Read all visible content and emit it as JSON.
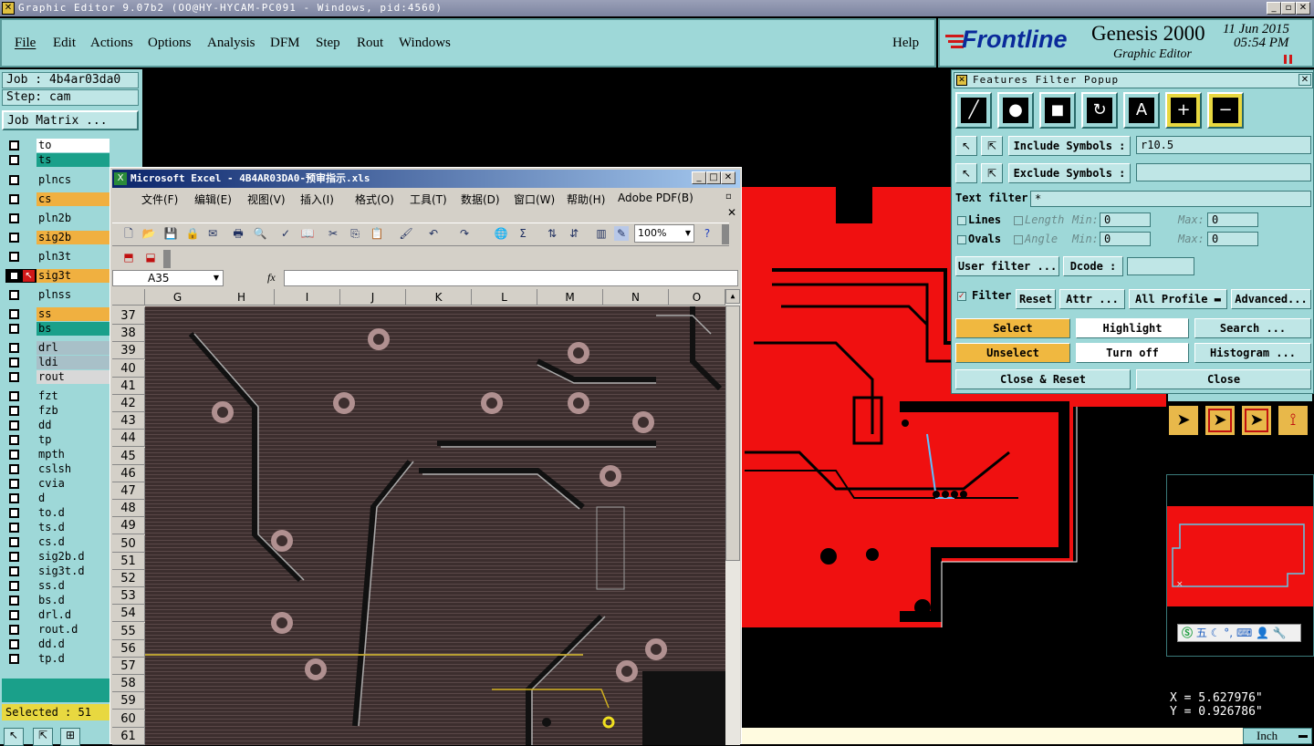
{
  "window": {
    "title": "Graphic Editor 9.07b2 (OO@HY-HYCAM-PC091 - Windows, pid:4560)"
  },
  "menubar": {
    "items": [
      "File",
      "Edit",
      "Actions",
      "Options",
      "Analysis",
      "DFM",
      "Step",
      "Rout",
      "Windows"
    ],
    "help": "Help"
  },
  "brand": {
    "logo": "Frontline",
    "product": "Genesis 2000",
    "subtitle": "Graphic Editor",
    "date": "11 Jun 2015",
    "time": "05:54 PM"
  },
  "leftpanel": {
    "job": "Job : 4b4ar03da0",
    "step": "Step: cam",
    "matrix": "Job Matrix ...",
    "selected": "Selected : 51",
    "layers": [
      {
        "name": "to",
        "color": "#ffffff"
      },
      {
        "name": "ts",
        "color": "#1aa08a"
      },
      {
        "name": "plncs",
        "color": "#9ed8d8"
      },
      {
        "name": "cs",
        "color": "#f0b040"
      },
      {
        "name": "pln2b",
        "color": "#9ed8d8"
      },
      {
        "name": "sig2b",
        "color": "#f0b040"
      },
      {
        "name": "pln3t",
        "color": "#9ed8d8"
      },
      {
        "name": "sig3t",
        "color": "#f0b040"
      },
      {
        "name": "plnss",
        "color": "#9ed8d8"
      },
      {
        "name": "ss",
        "color": "#f0b040"
      },
      {
        "name": "bs",
        "color": "#1aa08a"
      },
      {
        "name": "drl",
        "color": "#a8c0c8"
      },
      {
        "name": "ldi",
        "color": "#a8c0c8"
      },
      {
        "name": "rout",
        "color": "#d8d8d8"
      },
      {
        "name": "fzt",
        "color": "#9ed8d8"
      },
      {
        "name": "fzb",
        "color": "#9ed8d8"
      },
      {
        "name": "dd",
        "color": "#9ed8d8"
      },
      {
        "name": "tp",
        "color": "#9ed8d8"
      },
      {
        "name": "mpth",
        "color": "#9ed8d8"
      },
      {
        "name": "cslsh",
        "color": "#9ed8d8"
      },
      {
        "name": "cvia",
        "color": "#9ed8d8"
      },
      {
        "name": "d",
        "color": "#9ed8d8"
      },
      {
        "name": "to.d",
        "color": "#9ed8d8"
      },
      {
        "name": "ts.d",
        "color": "#9ed8d8"
      },
      {
        "name": "cs.d",
        "color": "#9ed8d8"
      },
      {
        "name": "sig2b.d",
        "color": "#9ed8d8"
      },
      {
        "name": "sig3t.d",
        "color": "#9ed8d8"
      },
      {
        "name": "ss.d",
        "color": "#9ed8d8"
      },
      {
        "name": "bs.d",
        "color": "#9ed8d8"
      },
      {
        "name": "drl.d",
        "color": "#9ed8d8"
      },
      {
        "name": "rout.d",
        "color": "#9ed8d8"
      },
      {
        "name": "dd.d",
        "color": "#9ed8d8"
      },
      {
        "name": "tp.d",
        "color": "#9ed8d8"
      }
    ]
  },
  "excel": {
    "title": "Microsoft Excel - 4B4AR03DA0-预审指示.xls",
    "menu": [
      "文件(F)",
      "编辑(E)",
      "视图(V)",
      "插入(I)",
      "格式(O)",
      "工具(T)",
      "数据(D)",
      "窗口(W)",
      "帮助(H)",
      "Adobe PDF(B)"
    ],
    "zoom": "100%",
    "namebox": "A35",
    "fx": "fx",
    "columns": [
      "G",
      "H",
      "I",
      "J",
      "K",
      "L",
      "M",
      "N",
      "O"
    ],
    "rows": [
      "37",
      "38",
      "39",
      "40",
      "41",
      "42",
      "43",
      "44",
      "45",
      "46",
      "47",
      "48",
      "49",
      "50",
      "51",
      "52",
      "53",
      "54",
      "55",
      "56",
      "57",
      "58",
      "59",
      "60",
      "61"
    ]
  },
  "filter": {
    "title": "Features Filter Popup",
    "include_label": "Include Symbols :",
    "include_value": "r10.5",
    "exclude_label": "Exclude Symbols :",
    "exclude_value": "",
    "text_filter_label": "Text filter",
    "text_filter_value": "*",
    "lines": "Lines",
    "ovals": "Ovals",
    "length": "Length",
    "angle": "Angle",
    "min": "Min:",
    "max": "Max:",
    "min_len": "0",
    "max_len": "0",
    "min_ang": "0",
    "max_ang": "0",
    "user_filter": "User filter ...",
    "dcode": "Dcode :",
    "dcode_value": "",
    "filter": "Filter",
    "reset": "Reset",
    "attr": "Attr ...",
    "profile": "All Profile",
    "advanced": "Advanced...",
    "select": "Select",
    "highlight": "Highlight",
    "search": "Search ...",
    "unselect": "Unselect",
    "turn_off": "Turn off",
    "histogram": "Histogram ...",
    "close_reset": "Close & Reset",
    "close": "Close"
  },
  "coords": {
    "x": "X = 5.627976\"",
    "y": "Y = 0.926786\"",
    "unit": "Inch"
  },
  "ime": {
    "label": "五"
  }
}
